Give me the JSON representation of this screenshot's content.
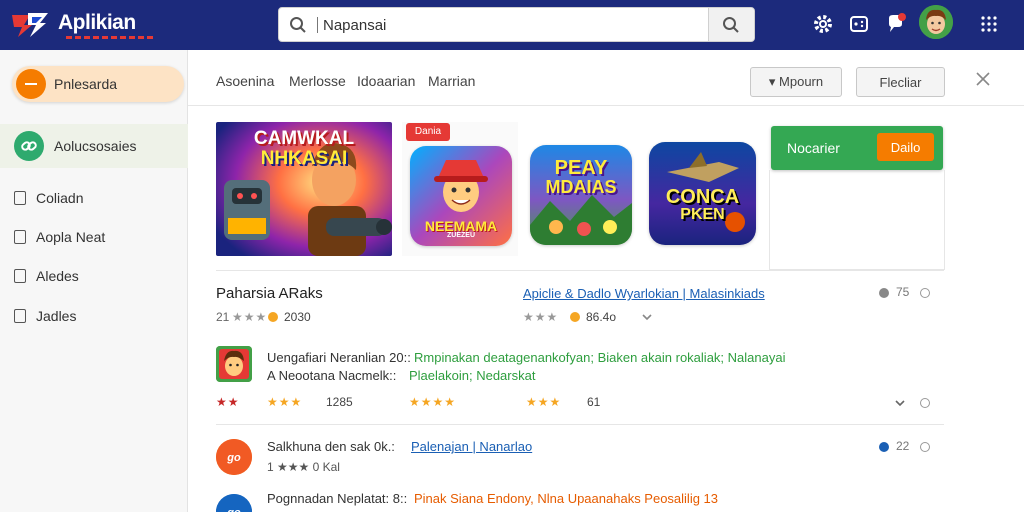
{
  "app": {
    "title": "Aplikian"
  },
  "search": {
    "value": "Napansai"
  },
  "sidebar": {
    "featured": "Pnlesarda",
    "active": "Aolucsosaies",
    "items": [
      {
        "label": "Coliadn"
      },
      {
        "label": "Aopla Neat"
      },
      {
        "label": "Aledes"
      },
      {
        "label": "Jadles"
      }
    ]
  },
  "tabs": [
    {
      "label": "Asoenina"
    },
    {
      "label": "Merlosse"
    },
    {
      "label": "Idoaarian"
    },
    {
      "label": "Marrian"
    }
  ],
  "toolbar": {
    "dropdown_label": "▾ Mpourn",
    "right_button": "Flecliar"
  },
  "banner": {
    "title_line1": "CAMWKAL",
    "title_line2": "NHKASAI"
  },
  "tiles": [
    {
      "tag": "Dania",
      "title": "NEEMAMA",
      "sub": "ZUEZEU"
    },
    {
      "title_line1": "PEAY",
      "title_line2": "MDAIAS"
    },
    {
      "title_line1": "CONCA",
      "title_line2": "PKEN"
    }
  ],
  "promo": {
    "label": "Nocarier",
    "button": "Dailo"
  },
  "featured_section": {
    "title": "Paharsia ARaks",
    "rating_text": "21",
    "rating_count": "2030",
    "links": "Apiclie & Dadlo Wyarlokian | Malasinkiads",
    "sub_rating": "86.4o",
    "right_count": "75"
  },
  "list": [
    {
      "line1_label": "Uengafiari Neranlian 20::",
      "line1_tail": "Rmpinakan deatagenankofyan; Biaken akain rokaliak; Nalanayai",
      "line2_label": "A Neootana Nacmelk::",
      "line2_tail": "Plaelakoin; Nedarskat",
      "stars_a": "★★",
      "stars_b": "★★★",
      "count_b": "1285",
      "stars_c": "★★★★",
      "stars_d": "★★★",
      "count_d": "61"
    },
    {
      "title": "Salkhuna den sak 0k.:",
      "links": "Palenajan | Nanarlao",
      "meta": "1 ★★★ 0 Kal",
      "right_count": "22"
    },
    {
      "title": "Pognnadan Neplatat: 8::",
      "tail": "Pinak Siana Endony, Nlna Upaanahaks Peosalilig 13"
    }
  ],
  "colors": {
    "topbar": "#1c2a7c",
    "accent_orange": "#f57c00",
    "accent_green": "#34a853",
    "link_blue": "#1a5fb4"
  }
}
